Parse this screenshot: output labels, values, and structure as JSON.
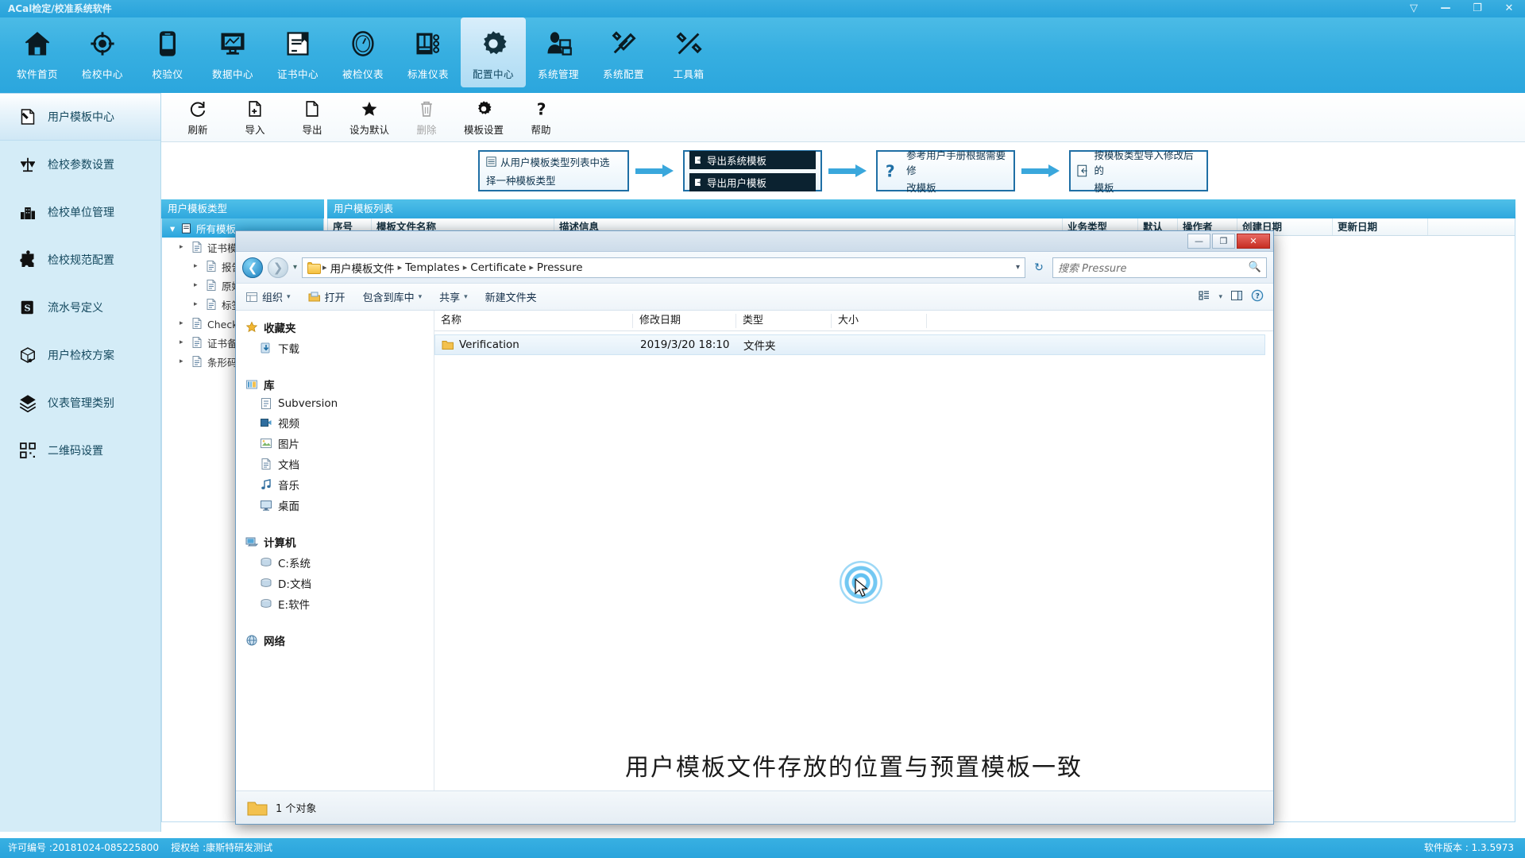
{
  "window": {
    "title": "ACal检定/校准系统软件",
    "buttons": [
      "minimize-ribbon",
      "minimize",
      "maximize",
      "close"
    ],
    "glyphs": {
      "ribbon": "▽",
      "min": "—",
      "max": "❐",
      "close": "✕"
    }
  },
  "ribbon": {
    "items": [
      {
        "label": "软件首页",
        "icon": "home-icon",
        "active": false
      },
      {
        "label": "检校中心",
        "icon": "target-icon",
        "active": false
      },
      {
        "label": "校验仪",
        "icon": "handheld-device-icon",
        "active": false
      },
      {
        "label": "数据中心",
        "icon": "chart-monitor-icon",
        "active": false
      },
      {
        "label": "证书中心",
        "icon": "certificate-book-icon",
        "active": false
      },
      {
        "label": "被检仪表",
        "icon": "gauge-icon",
        "active": false
      },
      {
        "label": "标准仪表",
        "icon": "instrument-rack-icon",
        "active": false
      },
      {
        "label": "配置中心",
        "icon": "gear-icon",
        "active": true
      },
      {
        "label": "系统管理",
        "icon": "user-computer-icon",
        "active": false
      },
      {
        "label": "系统配置",
        "icon": "wrench-screwdriver-icon",
        "active": false
      },
      {
        "label": "工具箱",
        "icon": "tools-icon",
        "active": false
      }
    ]
  },
  "sidebar": {
    "items": [
      {
        "label": "用户模板中心",
        "icon": "template-edit-icon",
        "active": true
      },
      {
        "label": "检校参数设置",
        "icon": "balance-scale-icon",
        "active": false
      },
      {
        "label": "检校单位管理",
        "icon": "building-icon",
        "active": false
      },
      {
        "label": "检校规范配置",
        "icon": "puzzle-icon",
        "active": false
      },
      {
        "label": "流水号定义",
        "icon": "serial-number-icon",
        "active": false
      },
      {
        "label": "用户检校方案",
        "icon": "box-package-icon",
        "active": false
      },
      {
        "label": "仪表管理类别",
        "icon": "category-icon",
        "active": false
      },
      {
        "label": "二维码设置",
        "icon": "qrcode-icon",
        "active": false
      }
    ]
  },
  "toolbar": {
    "items": [
      {
        "label": "刷新",
        "icon": "refresh-icon",
        "disabled": false
      },
      {
        "label": "导入",
        "icon": "import-file-icon",
        "disabled": false
      },
      {
        "label": "导出",
        "icon": "export-file-icon",
        "disabled": false
      },
      {
        "label": "设为默认",
        "icon": "star-icon",
        "disabled": false
      },
      {
        "label": "删除",
        "icon": "trash-icon",
        "disabled": true
      },
      {
        "label": "模板设置",
        "icon": "settings-gear-icon",
        "disabled": false
      },
      {
        "label": "帮助",
        "icon": "help-question-icon",
        "disabled": false
      }
    ]
  },
  "flow": {
    "steps": [
      {
        "lines": [
          "从用户模板类型列表中选",
          "择一种模板类型"
        ],
        "style": "plain",
        "icon": "list-icon"
      },
      {
        "lines": [
          "导出系统模板",
          "导出用户模板"
        ],
        "style": "bars",
        "icon": "export-icon"
      },
      {
        "lines": [
          "参考用户手册根据需要修",
          "改模板"
        ],
        "style": "question",
        "icon": "question-icon"
      },
      {
        "lines": [
          "按模板类型导入修改后的",
          "模板"
        ],
        "style": "plain",
        "icon": "import-icon"
      }
    ]
  },
  "panels": {
    "left_header": "用户模板类型",
    "right_header": "用户模板列表",
    "tree_root": "所有模板",
    "tree_nodes": [
      "证书模板",
      "报告模板",
      "原始记录",
      "标签模板",
      "Check模板",
      "证书备份",
      "条形码模板"
    ],
    "columns": [
      "序号",
      "模板文件名称",
      "描述信息",
      "业务类型",
      "默认",
      "操作者",
      "创建日期",
      "更新日期"
    ]
  },
  "status": {
    "license": "许可编号 :20181024-085225800",
    "licensee": "授权给 :康斯特研发测试",
    "version": "软件版本 : 1.3.5973"
  },
  "explorer": {
    "window_buttons": {
      "min": "—",
      "max": "❐",
      "close": "✕"
    },
    "breadcrumb": [
      "用户模板文件",
      "Templates",
      "Certificate",
      "Pressure"
    ],
    "breadcrumb_sep": "▸",
    "search_placeholder": "搜索 Pressure",
    "search_icon": "search-icon",
    "refresh_icon": "refresh-icon",
    "back_icon": "back-arrow-icon",
    "forward_icon": "forward-arrow-icon",
    "dropdown_icon": "chevron-down-icon",
    "commands": [
      {
        "label": "组织",
        "icon": "organize-icon",
        "caret": "▾"
      },
      {
        "label": "打开",
        "icon": "open-folder-icon",
        "caret": ""
      },
      {
        "label": "包含到库中",
        "icon": "",
        "caret": "▾"
      },
      {
        "label": "共享",
        "icon": "",
        "caret": "▾"
      },
      {
        "label": "新建文件夹",
        "icon": "",
        "caret": ""
      }
    ],
    "view_icons": [
      "list-view-icon",
      "chevron-down-icon",
      "preview-pane-icon",
      "help-icon"
    ],
    "nav_tree": [
      {
        "label": "收藏夹",
        "icon": "favorites-star-icon",
        "level": 0
      },
      {
        "label": "下载",
        "icon": "downloads-icon",
        "level": 1
      },
      {
        "label": "库",
        "icon": "library-icon",
        "level": 0
      },
      {
        "label": "Subversion",
        "icon": "subversion-icon",
        "level": 1
      },
      {
        "label": "视频",
        "icon": "video-icon",
        "level": 1
      },
      {
        "label": "图片",
        "icon": "pictures-icon",
        "level": 1
      },
      {
        "label": "文档",
        "icon": "documents-icon",
        "level": 1
      },
      {
        "label": "音乐",
        "icon": "music-icon",
        "level": 1
      },
      {
        "label": "桌面",
        "icon": "desktop-icon",
        "level": 1
      },
      {
        "label": "计算机",
        "icon": "computer-icon",
        "level": 0
      },
      {
        "label": "C:系统",
        "icon": "harddisk-icon",
        "level": 1
      },
      {
        "label": "D:文档",
        "icon": "harddisk-icon",
        "level": 1
      },
      {
        "label": "E:软件",
        "icon": "harddisk-icon",
        "level": 1
      },
      {
        "label": "网络",
        "icon": "network-icon",
        "level": 0
      }
    ],
    "columns": [
      "名称",
      "修改日期",
      "类型",
      "大小"
    ],
    "files": [
      {
        "name": "Verification",
        "modified": "2019/3/20 18:10",
        "type": "文件夹",
        "size": "",
        "icon": "folder-icon",
        "selected": true
      }
    ],
    "watermark": "用户模板文件存放的位置与预置模板一致",
    "status_text": "1 个对象",
    "status_icon": "folder-icon"
  },
  "colors": {
    "brand_blue": "#2ba6dd",
    "ribbon_blue": "#37afe1",
    "sidebar_blue": "#d4ecf7",
    "selection_blue": "#2ba5dd",
    "close_red": "#c62d22",
    "folder_yellow": "#f5bf3d"
  }
}
